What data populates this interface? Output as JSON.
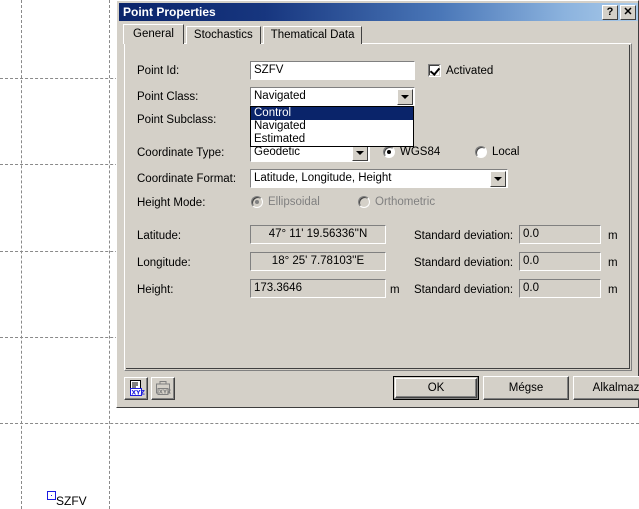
{
  "map": {
    "point_marker_label": "SZFV",
    "grid_color": "#8a8a8a",
    "marker_color": "#1c1ce0"
  },
  "dialog": {
    "title": "Point Properties",
    "help_button": "?",
    "close_button": "✕",
    "titlebar_color_start": "#0a246a",
    "titlebar_color_end": "#a9cae9",
    "tabs": [
      {
        "label": "General",
        "active": true
      },
      {
        "label": "Stochastics",
        "active": false
      },
      {
        "label": "Thematical Data",
        "active": false
      }
    ],
    "fields": {
      "point_id_label": "Point Id:",
      "point_id_value": "SZFV",
      "activated_label": "Activated",
      "activated_checked": true,
      "point_class_label": "Point Class:",
      "point_class_value": "Navigated",
      "point_class_options": [
        {
          "label": "Control",
          "selected": true
        },
        {
          "label": "Navigated",
          "selected": false
        },
        {
          "label": "Estimated",
          "selected": false
        }
      ],
      "point_subclass_label": "Point Subclass:",
      "coordinate_type_label": "Coordinate Type:",
      "coordinate_type_value": "Geodetic",
      "datum_wgs84_label": "WGS84",
      "datum_wgs84_selected": true,
      "datum_local_label": "Local",
      "datum_local_selected": false,
      "coordinate_format_label": "Coordinate Format:",
      "coordinate_format_value": "Latitude, Longitude, Height",
      "height_mode_label": "Height Mode:",
      "height_mode_ellipsoidal_label": "Ellipsoidal",
      "height_mode_ellipsoidal_selected": true,
      "height_mode_orthometric_label": "Orthometric",
      "height_mode_orthometric_selected": false,
      "latitude_label": "Latitude:",
      "latitude_value": "47° 11' 19.56336''N",
      "longitude_label": "Longitude:",
      "longitude_value": "18° 25'  7.78103''E",
      "height_label": "Height:",
      "height_value": "173.3646",
      "height_unit": "m",
      "std_dev_label": "Standard deviation:",
      "std_dev_latitude_value": "0.0",
      "std_dev_longitude_value": "0.0",
      "std_dev_height_value": "0.0",
      "std_dev_unit": "m"
    },
    "buttons": {
      "ok": "OK",
      "cancel": "Mégse",
      "apply": "Alkalmaz",
      "export_xyz_icon": "document-xyz-icon",
      "import_xyz_icon": "case-xyz-icon"
    }
  }
}
